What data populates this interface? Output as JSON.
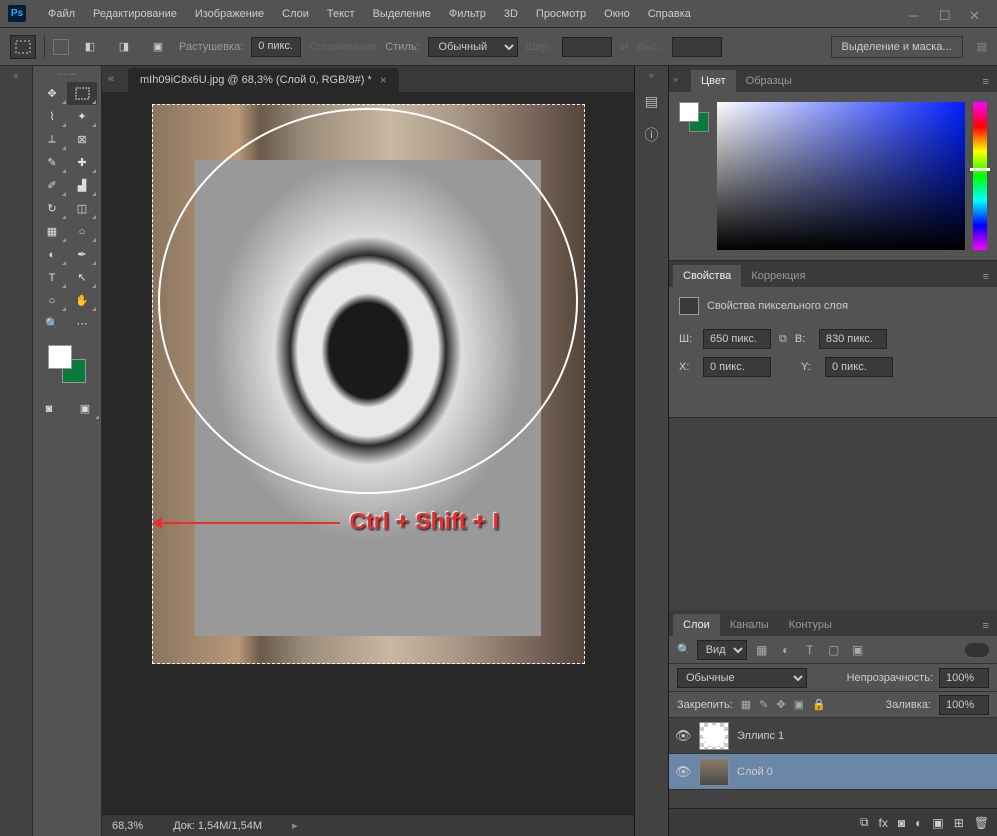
{
  "app": {
    "logo": "Ps"
  },
  "menu": {
    "file": "Файл",
    "edit": "Редактирование",
    "image": "Изображение",
    "layer": "Слои",
    "type": "Текст",
    "select": "Выделение",
    "filter": "Фильтр",
    "threed": "3D",
    "view": "Просмотр",
    "window": "Окно",
    "help": "Справка"
  },
  "optbar": {
    "feather_label": "Растушевка:",
    "feather_value": "0 пикс.",
    "antialias": "Сглаживание",
    "style_label": "Стиль:",
    "style_value": "Обычный",
    "width_label": "Шир.:",
    "height_label": "Выс.:",
    "select_mask": "Выделение и маска..."
  },
  "doc": {
    "tab_title": "mIh09iC8x6U.jpg @ 68,3% (Слой 0, RGB/8#) *",
    "zoom": "68,3%",
    "docsize": "Док: 1,54M/1,54M",
    "annotation": "Ctrl + Shift + I"
  },
  "panels": {
    "color_tab": "Цвет",
    "swatches_tab": "Образцы",
    "props_tab": "Свойства",
    "adjust_tab": "Коррекция",
    "props_title": "Свойства пиксельного слоя",
    "w_label": "Ш:",
    "w_value": "650 пикс.",
    "h_label": "В:",
    "h_value": "830 пикс.",
    "x_label": "X:",
    "x_value": "0 пикс.",
    "y_label": "Y:",
    "y_value": "0 пикс.",
    "layers_tab": "Слои",
    "channels_tab": "Каналы",
    "paths_tab": "Контуры"
  },
  "layers": {
    "filter_kind": "Вид",
    "blend_mode": "Обычные",
    "opacity_label": "Непрозрачность:",
    "opacity_value": "100%",
    "lock_label": "Закрепить:",
    "fill_label": "Заливка:",
    "fill_value": "100%",
    "items": [
      {
        "name": "Эллипс 1"
      },
      {
        "name": "Слой 0"
      }
    ]
  }
}
